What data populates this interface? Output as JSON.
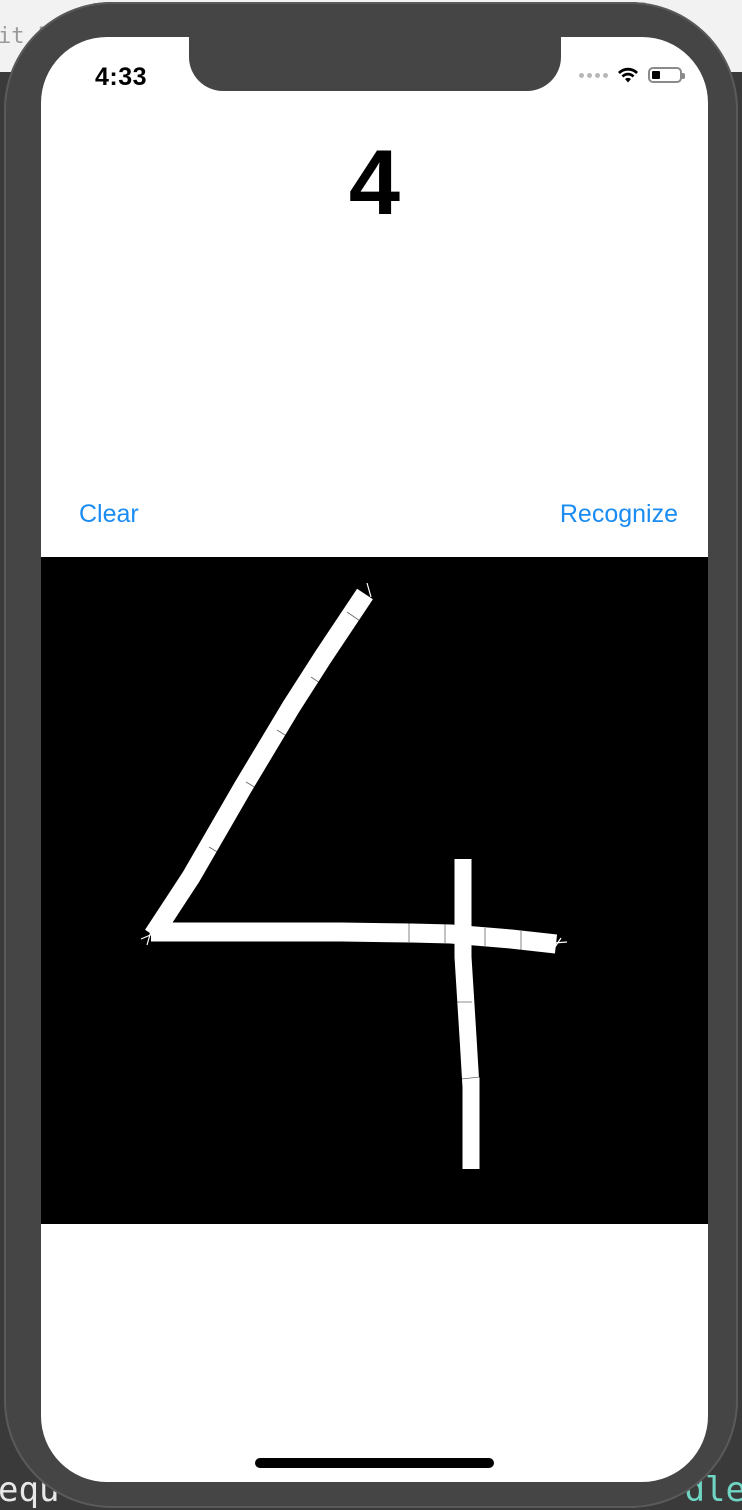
{
  "background": {
    "top_text": "it P",
    "bottom_left_text": "equ",
    "bottom_right_text": "dle"
  },
  "status_bar": {
    "time": "4:33",
    "signal_icon": "signal-dots-icon",
    "wifi_icon": "wifi-icon",
    "battery_icon": "battery-icon",
    "battery_level": 0.3
  },
  "result": {
    "digit": "4"
  },
  "toolbar": {
    "clear_label": "Clear",
    "recognize_label": "Recognize",
    "accent_color": "#1a8cf2"
  },
  "canvas": {
    "background_color": "#000000",
    "stroke_color": "#ffffff"
  }
}
